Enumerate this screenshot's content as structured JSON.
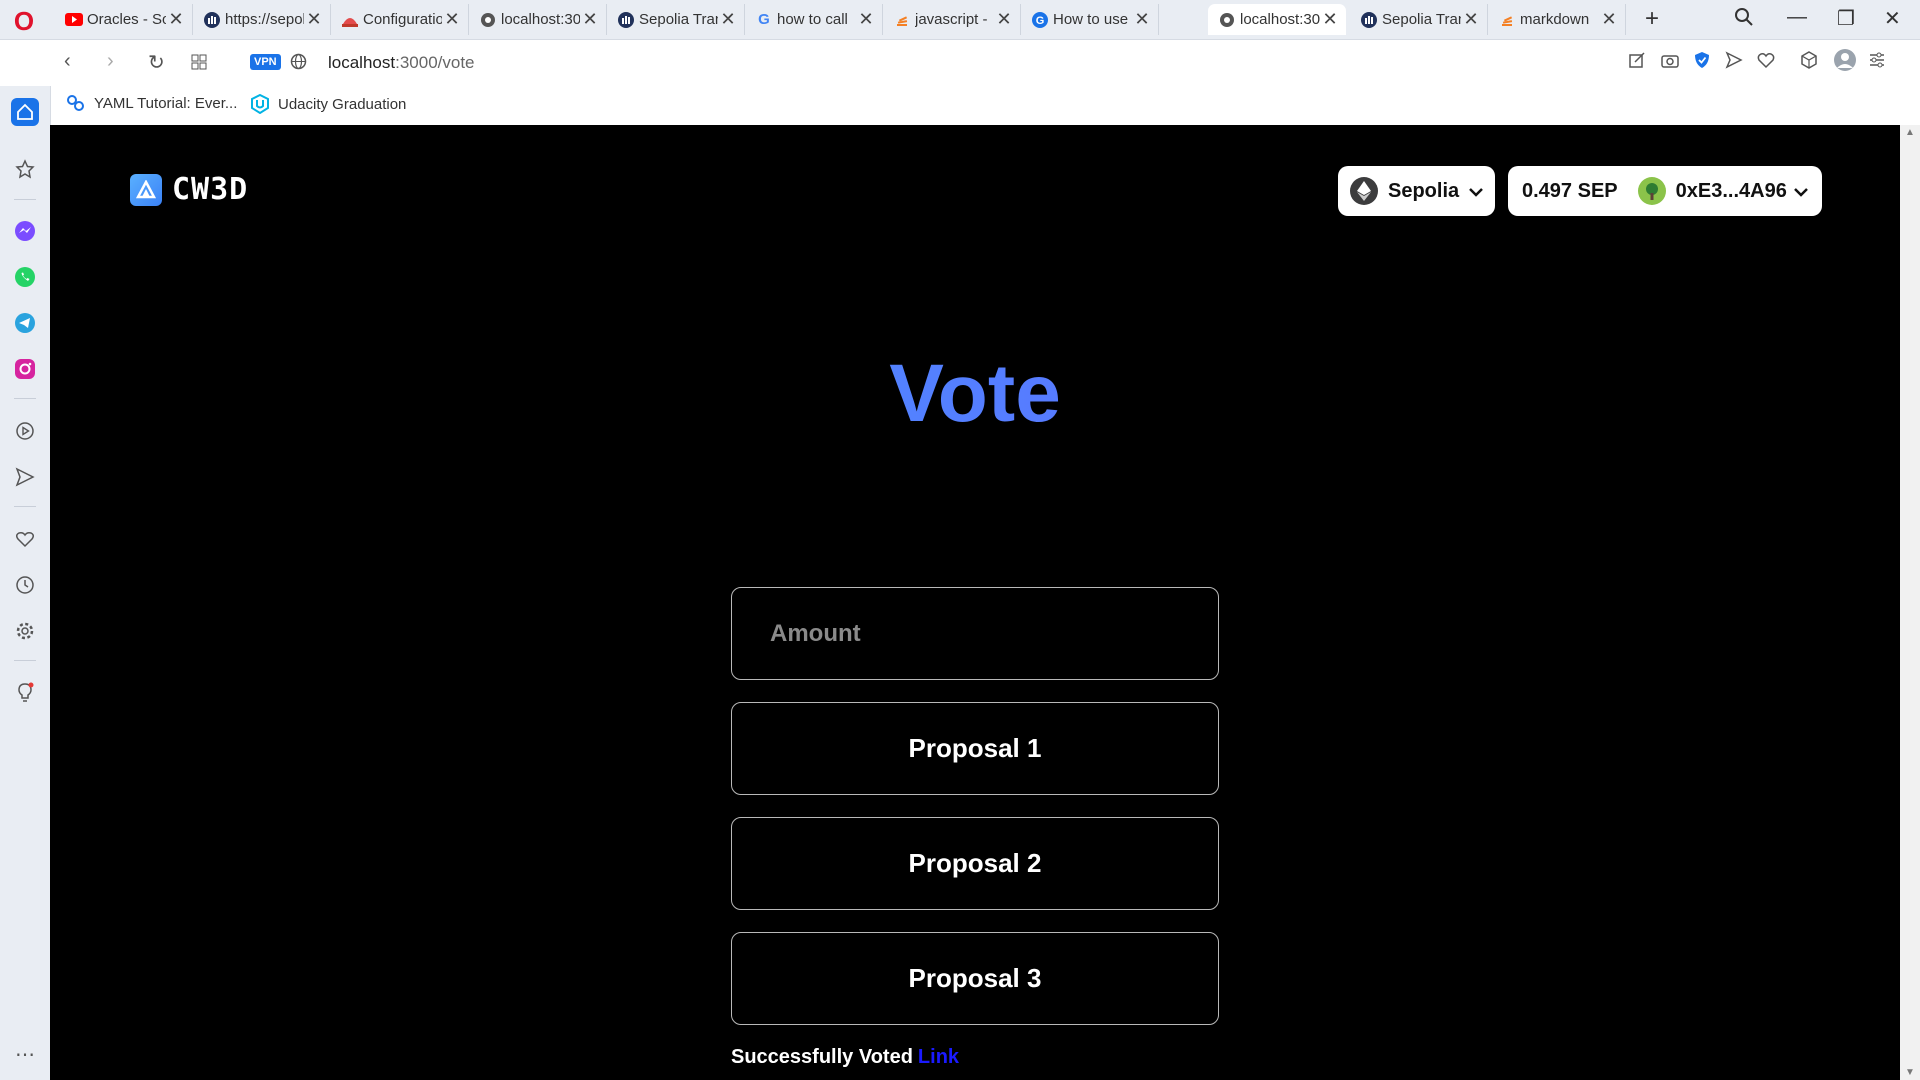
{
  "browser": {
    "tabs": [
      {
        "title": "Oracles - Sol",
        "icon": "youtube-icon",
        "active": false
      },
      {
        "title": "https://sepolia",
        "icon": "opensea-icon",
        "active": false
      },
      {
        "title": "Configuration",
        "icon": "hardhat-icon",
        "active": false
      },
      {
        "title": "localhost:3000",
        "icon": "globe-icon",
        "active": false
      },
      {
        "title": "Sepolia Tran",
        "icon": "etherscan-icon",
        "active": false
      },
      {
        "title": "how to call",
        "icon": "google-icon",
        "active": false
      },
      {
        "title": "javascript -",
        "icon": "stackoverflow-icon",
        "active": false
      },
      {
        "title": "How to use",
        "icon": "google-icon",
        "active": false
      },
      {
        "title": "localhost:3000",
        "icon": "globe-icon",
        "active": true
      },
      {
        "title": "Sepolia Tran",
        "icon": "etherscan-icon",
        "active": false
      },
      {
        "title": "markdown",
        "icon": "stackoverflow-icon",
        "active": false
      }
    ],
    "url_host": "localhost",
    "url_path": ":3000/vote",
    "vpn_label": "VPN",
    "bookmarks": [
      {
        "label": "YAML Tutorial: Ever...",
        "icon": "yaml-icon"
      },
      {
        "label": "Udacity Graduation",
        "icon": "udacity-icon"
      }
    ]
  },
  "app": {
    "logo_text": "CW3D",
    "network": "Sepolia",
    "balance": "0.497 SEP",
    "address": "0xE3...4A96",
    "title": "Vote",
    "amount_placeholder": "Amount",
    "proposals": [
      "Proposal 1",
      "Proposal 2",
      "Proposal 3"
    ],
    "status_text": "Successfully Voted",
    "status_link": "Link"
  },
  "colors": {
    "accent_gradient_start": "#3fa1ff",
    "accent_gradient_end": "#6a5cff",
    "link": "#1a1aff",
    "background": "#000000"
  }
}
